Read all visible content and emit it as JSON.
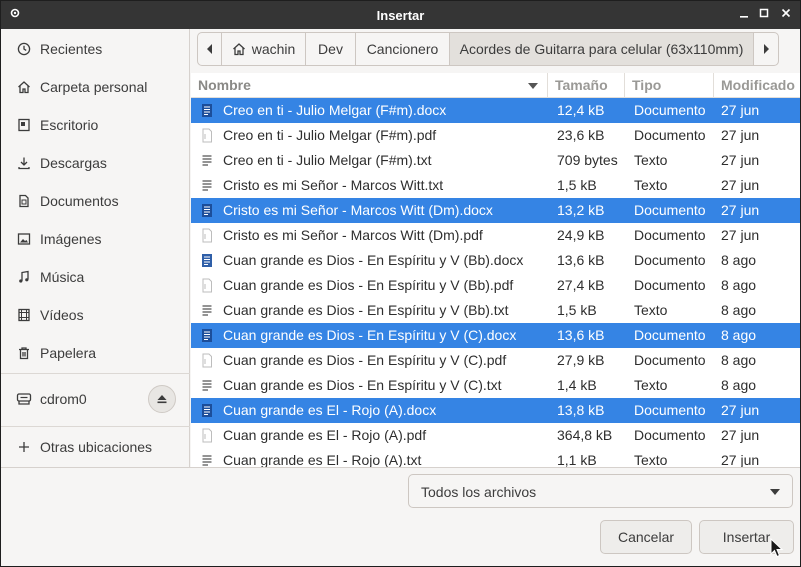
{
  "window": {
    "title": "Insertar"
  },
  "sidebar": {
    "items": [
      {
        "label": "Recientes",
        "icon": "clock-icon"
      },
      {
        "label": "Carpeta personal",
        "icon": "home-icon"
      },
      {
        "label": "Escritorio",
        "icon": "desktop-icon"
      },
      {
        "label": "Descargas",
        "icon": "download-icon"
      },
      {
        "label": "Documentos",
        "icon": "document-icon"
      },
      {
        "label": "Imágenes",
        "icon": "image-icon"
      },
      {
        "label": "Música",
        "icon": "music-icon"
      },
      {
        "label": "Vídeos",
        "icon": "video-icon"
      },
      {
        "label": "Papelera",
        "icon": "trash-icon"
      }
    ],
    "device": {
      "label": "cdrom0",
      "icon": "drive-icon"
    },
    "other": {
      "label": "Otras ubicaciones",
      "icon": "plus-icon"
    }
  },
  "pathbar": {
    "crumbs": [
      "wachin",
      "Dev",
      "Cancionero",
      "Acordes de Guitarra para celular (63x110mm)"
    ]
  },
  "table": {
    "headers": {
      "name": "Nombre",
      "size": "Tamaño",
      "type": "Tipo",
      "modified": "Modificado"
    },
    "rows": [
      {
        "name": "Creo en ti - Julio Melgar (F#m).docx",
        "size": "12,4 kB",
        "type": "Documento",
        "modified": "27 jun",
        "kind": "docx",
        "selected": true
      },
      {
        "name": "Creo en ti - Julio Melgar (F#m).pdf",
        "size": "23,6 kB",
        "type": "Documento",
        "modified": "27 jun",
        "kind": "pdf",
        "selected": false
      },
      {
        "name": "Creo en ti - Julio Melgar (F#m).txt",
        "size": "709 bytes",
        "type": "Texto",
        "modified": "27 jun",
        "kind": "txt",
        "selected": false
      },
      {
        "name": "Cristo es mi Señor - Marcos Witt.txt",
        "size": "1,5 kB",
        "type": "Texto",
        "modified": "27 jun",
        "kind": "txt",
        "selected": false
      },
      {
        "name": "Cristo es mi Señor - Marcos Witt (Dm).docx",
        "size": "13,2 kB",
        "type": "Documento",
        "modified": "27 jun",
        "kind": "docx",
        "selected": true
      },
      {
        "name": "Cristo es mi Señor - Marcos Witt (Dm).pdf",
        "size": "24,9 kB",
        "type": "Documento",
        "modified": "27 jun",
        "kind": "pdf",
        "selected": false
      },
      {
        "name": "Cuan grande es Dios - En Espíritu y V (Bb).docx",
        "size": "13,6 kB",
        "type": "Documento",
        "modified": "8 ago",
        "kind": "docx",
        "selected": false
      },
      {
        "name": "Cuan grande es Dios - En Espíritu y V (Bb).pdf",
        "size": "27,4 kB",
        "type": "Documento",
        "modified": "8 ago",
        "kind": "pdf",
        "selected": false
      },
      {
        "name": "Cuan grande es Dios - En Espíritu y V (Bb).txt",
        "size": "1,5 kB",
        "type": "Texto",
        "modified": "8 ago",
        "kind": "txt",
        "selected": false
      },
      {
        "name": "Cuan grande es Dios - En Espíritu y V (C).docx",
        "size": "13,6 kB",
        "type": "Documento",
        "modified": "8 ago",
        "kind": "docx",
        "selected": true
      },
      {
        "name": "Cuan grande es Dios - En Espíritu y V (C).pdf",
        "size": "27,9 kB",
        "type": "Documento",
        "modified": "8 ago",
        "kind": "pdf",
        "selected": false
      },
      {
        "name": "Cuan grande es Dios - En Espíritu y V (C).txt",
        "size": "1,4 kB",
        "type": "Texto",
        "modified": "8 ago",
        "kind": "txt",
        "selected": false
      },
      {
        "name": "Cuan grande es El - Rojo (A).docx",
        "size": "13,8 kB",
        "type": "Documento",
        "modified": "27 jun",
        "kind": "docx",
        "selected": true
      },
      {
        "name": "Cuan grande es El - Rojo (A).pdf",
        "size": "364,8 kB",
        "type": "Documento",
        "modified": "27 jun",
        "kind": "pdf",
        "selected": false
      },
      {
        "name": "Cuan grande es El - Rojo (A).txt",
        "size": "1,1 kB",
        "type": "Texto",
        "modified": "27 jun",
        "kind": "txt",
        "selected": false
      }
    ]
  },
  "footer": {
    "filter": "Todos los archivos",
    "cancel": "Cancelar",
    "insert": "Insertar"
  },
  "colors": {
    "selection": "#3584e4",
    "titlebar": "#353535"
  }
}
